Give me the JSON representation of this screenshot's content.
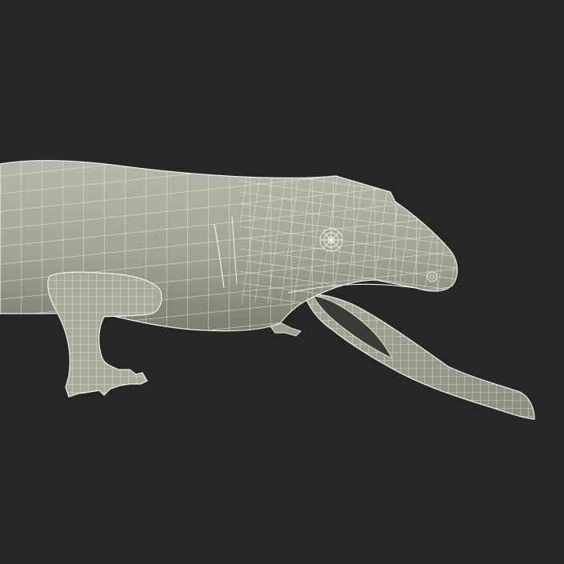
{
  "scene": {
    "subject": "lizard-wireframe-render",
    "colors": {
      "background": "#262626",
      "skin_light": "#b3b3a4",
      "skin_mid": "#9c9c8e",
      "skin_dark": "#6f6f64",
      "mouth_dark": "#3a3a36",
      "wire": "#f2f2e6"
    }
  }
}
